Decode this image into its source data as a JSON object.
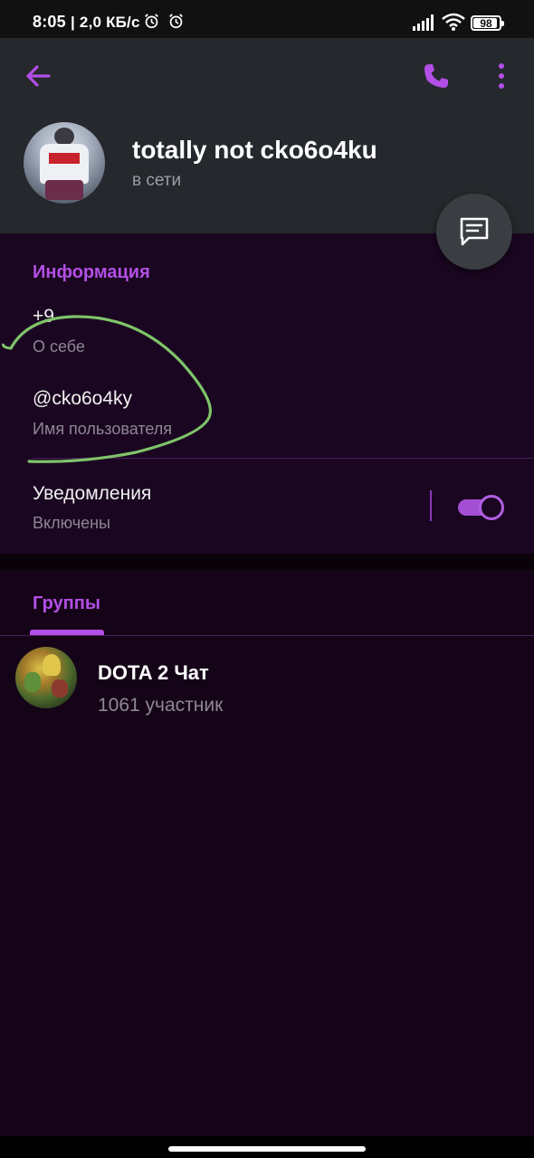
{
  "status_bar": {
    "time": "8:05",
    "speed": "| 2,0 КБ/с",
    "battery": "98"
  },
  "header": {
    "contact_name": "totally not cko6o4ku",
    "contact_status": "в сети",
    "icons": [
      "back-arrow-icon",
      "phone-icon",
      "more-vertical-icon",
      "message-icon"
    ],
    "accent_color": "#b24fe6"
  },
  "info": {
    "title": "Информация",
    "bio_value": "+9",
    "bio_label": "О себе",
    "username_value": "@cko6o4ky",
    "username_label": "Имя пользователя",
    "notifications_label": "Уведомления",
    "notifications_status": "Включены",
    "notifications_enabled": true
  },
  "groups": {
    "tab_label": "Группы",
    "items": [
      {
        "name": "DOTA 2 Чат",
        "members": "1061 участник"
      }
    ]
  }
}
